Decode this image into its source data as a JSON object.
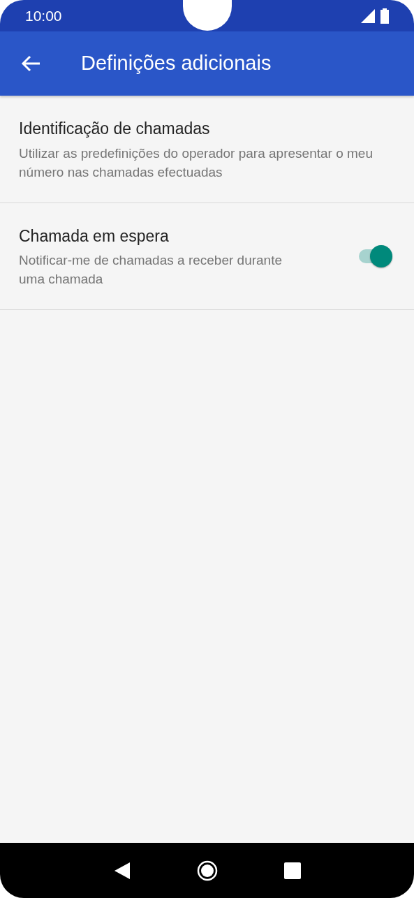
{
  "status_bar": {
    "time": "10:00"
  },
  "app_bar": {
    "title": "Definições adicionais"
  },
  "settings": [
    {
      "kind": "text",
      "title": "Identificação de chamadas",
      "summary": "Utilizar as predefinições do operador para apresentar o meu número nas chamadas efectuadas"
    },
    {
      "kind": "switch",
      "title": "Chamada em espera",
      "summary": "Notificar-me de chamadas a receber durante uma chamada",
      "on": true
    }
  ]
}
